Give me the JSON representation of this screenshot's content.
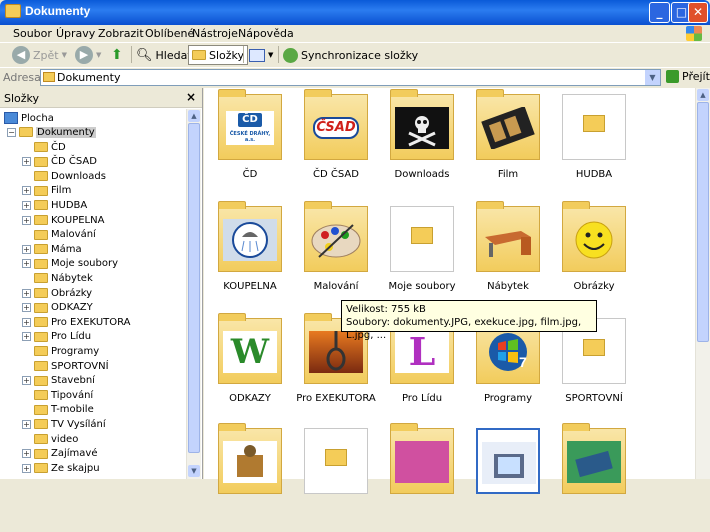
{
  "window": {
    "title": "Dokumenty"
  },
  "menu": [
    "Soubor",
    "Úpravy",
    "Zobrazit",
    "Oblíbené",
    "Nástroje",
    "Nápověda"
  ],
  "toolbar": {
    "back": "Zpět",
    "search": "Hledat",
    "folders": "Složky",
    "sync": "Synchronizace složky"
  },
  "address": {
    "label": "Adresa",
    "value": "Dokumenty",
    "go": "Přejít"
  },
  "tree": {
    "title": "Složky",
    "close": "×",
    "desktop": "Plocha",
    "root": "Dokumenty",
    "items": [
      {
        "label": "ČD",
        "expand": ""
      },
      {
        "label": "ČD ČSAD",
        "expand": "+"
      },
      {
        "label": "Downloads",
        "expand": ""
      },
      {
        "label": "Film",
        "expand": "+"
      },
      {
        "label": "HUDBA",
        "expand": "+"
      },
      {
        "label": "KOUPELNA",
        "expand": "+"
      },
      {
        "label": "Malování",
        "expand": ""
      },
      {
        "label": "Máma",
        "expand": "+"
      },
      {
        "label": "Moje soubory",
        "expand": "+"
      },
      {
        "label": "Nábytek",
        "expand": ""
      },
      {
        "label": "Obrázky",
        "expand": "+"
      },
      {
        "label": "ODKAZY",
        "expand": "+"
      },
      {
        "label": "Pro EXEKUTORA",
        "expand": "+"
      },
      {
        "label": "Pro Lídu",
        "expand": "+"
      },
      {
        "label": "Programy",
        "expand": ""
      },
      {
        "label": "SPORTOVNÍ",
        "expand": ""
      },
      {
        "label": "Stavební",
        "expand": "+"
      },
      {
        "label": "Tipování",
        "expand": ""
      },
      {
        "label": "T-mobile",
        "expand": ""
      },
      {
        "label": "TV Vysílání",
        "expand": "+"
      },
      {
        "label": "video",
        "expand": ""
      },
      {
        "label": "Zajímavé",
        "expand": "+"
      },
      {
        "label": "Ze skajpu",
        "expand": "+"
      }
    ]
  },
  "folders": [
    {
      "label": "ČD",
      "thumb": "CD"
    },
    {
      "label": "ČD ČSAD",
      "thumb": "CSAD"
    },
    {
      "label": "Downloads",
      "thumb": "pirate"
    },
    {
      "label": "Film",
      "thumb": "film"
    },
    {
      "label": "HUDBA",
      "thumb": "empty"
    },
    {
      "label": "KOUPELNA",
      "thumb": "shower"
    },
    {
      "label": "Malování",
      "thumb": "paint"
    },
    {
      "label": "Moje soubory",
      "thumb": "empty"
    },
    {
      "label": "Nábytek",
      "thumb": "desk"
    },
    {
      "label": "Obrázky",
      "thumb": "smiley"
    },
    {
      "label": "ODKAZY",
      "thumb": "W"
    },
    {
      "label": "Pro EXEKUTORA",
      "thumb": "noose"
    },
    {
      "label": "Pro Lídu",
      "thumb": "L"
    },
    {
      "label": "Programy",
      "thumb": "win7"
    },
    {
      "label": "SPORTOVNÍ",
      "thumb": "empty"
    }
  ],
  "thumb_text": {
    "cd": "ČD",
    "cd_sub": "ČESKÉ DRÁHY, a.s.",
    "csad": "ČSAD",
    "w": "W",
    "l": "L",
    "seven": "7"
  },
  "tooltip": {
    "size": "Velikost: 755 kB",
    "files": "Soubory: dokumenty.JPG, exekuce.jpg, film.jpg, L.jpg, ..."
  }
}
